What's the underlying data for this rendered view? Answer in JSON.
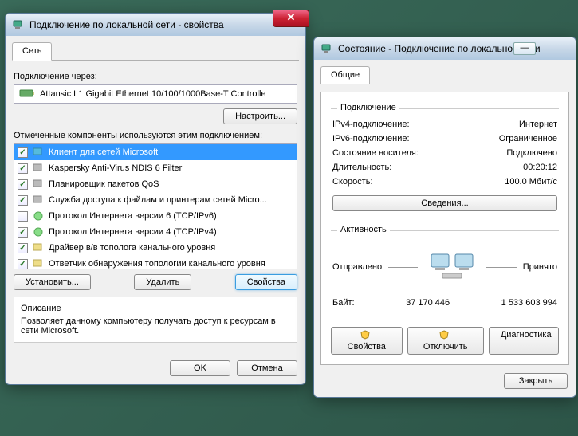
{
  "props": {
    "title": "Подключение по локальной сети - свойства",
    "tab": "Сеть",
    "connect_via_label": "Подключение через:",
    "adapter": "Attansic L1 Gigabit Ethernet 10/100/1000Base-T Controlle",
    "configure_btn": "Настроить...",
    "components_label": "Отмеченные компоненты используются этим подключением:",
    "components": [
      "Клиент для сетей Microsoft",
      "Kaspersky Anti-Virus NDIS 6 Filter",
      "Планировщик пакетов QoS",
      "Служба доступа к файлам и принтерам сетей Micro...",
      "Протокол Интернета версии 6 (TCP/IPv6)",
      "Протокол Интернета версии 4 (TCP/IPv4)",
      "Драйвер в/в тополога канального уровня",
      "Ответчик обнаружения топологии канального уровня"
    ],
    "install_btn": "Установить...",
    "remove_btn": "Удалить",
    "properties_btn": "Свойства",
    "desc_title": "Описание",
    "desc_text": "Позволяет данному компьютеру получать доступ к ресурсам в сети Microsoft.",
    "ok_btn": "OK",
    "cancel_btn": "Отмена"
  },
  "status": {
    "title": "Состояние - Подключение по локальной сети",
    "tab": "Общие",
    "conn_legend": "Подключение",
    "rows": {
      "ipv4_label": "IPv4-подключение:",
      "ipv4_val": "Интернет",
      "ipv6_label": "IPv6-подключение:",
      "ipv6_val": "Ограниченное",
      "media_label": "Состояние носителя:",
      "media_val": "Подключено",
      "duration_label": "Длительность:",
      "duration_val": "00:20:12",
      "speed_label": "Скорость:",
      "speed_val": "100.0 Мбит/с"
    },
    "details_btn": "Сведения...",
    "activity_legend": "Активность",
    "sent_label": "Отправлено",
    "recv_label": "Принято",
    "bytes_label": "Байт:",
    "sent_bytes": "37 170 446",
    "recv_bytes": "1 533 603 994",
    "props_btn": "Свойства",
    "disable_btn": "Отключить",
    "diag_btn": "Диагностика",
    "close_btn": "Закрыть"
  }
}
